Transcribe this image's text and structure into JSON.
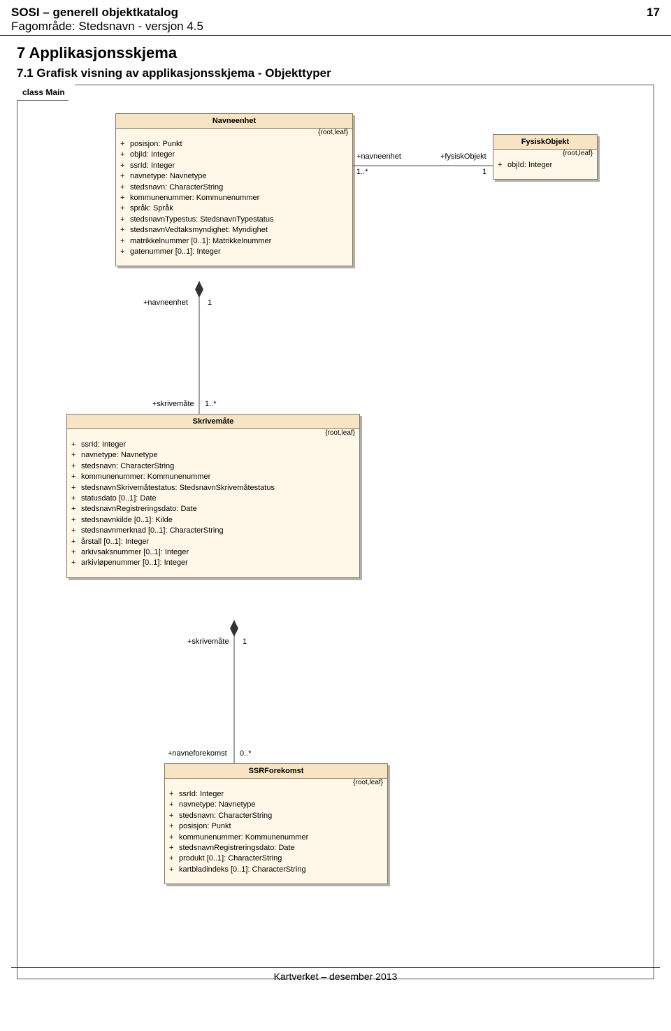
{
  "header": {
    "title_left": "SOSI – generell objektkatalog",
    "page_number": "17",
    "subtitle": "Fagområde: Stedsnavn - versjon 4.5"
  },
  "section": {
    "h1": "7 Applikasjonsskjema",
    "h2": "7.1 Grafisk visning av applikasjonsskjema - Objekttyper",
    "frame_label": "class Main"
  },
  "navneenhet": {
    "title": "Navneenhet",
    "constraint": "{root,leaf}",
    "attrs": [
      "posisjon: Punkt",
      "objId: Integer",
      "ssrId: Integer",
      "navnetype: Navnetype",
      "stedsnavn: CharacterString",
      "kommunenummer: Kommunenummer",
      "språk: Språk",
      "stedsnavnTypestus: StedsnavnTypestatus",
      "stedsnavnVedtaksmyndighet: Myndighet",
      "matrikkelnummer [0..1]: Matrikkelnummer",
      "gatenummer [0..1]: Integer"
    ]
  },
  "fysiskobjekt": {
    "title": "FysiskObjekt",
    "constraint": "{root,leaf}",
    "attr": "objId: Integer"
  },
  "assoc1": {
    "role_left": "+navneenhet",
    "mult_left": "1..*",
    "role_right": "+fysiskObjekt",
    "mult_right": "1"
  },
  "assoc2": {
    "role_top": "+navneenhet",
    "mult_top": "1",
    "role_bottom": "+skrivemåte",
    "mult_bottom": "1..*"
  },
  "skrivemate": {
    "title": "Skrivemåte",
    "constraint": "{root,leaf}",
    "attrs": [
      "ssrId: Integer",
      "navnetype: Navnetype",
      "stedsnavn: CharacterString",
      "kommunenummer: Kommunenummer",
      "stedsnavnSkrivemåtestatus: StedsnavnSkrivemåtestatus",
      "statusdato [0..1]: Date",
      "stedsnavnRegistreringsdato: Date",
      "stedsnavnkilde [0..1]: Kilde",
      "stedsnavnmerknad [0..1]: CharacterString",
      "årstall [0..1]: Integer",
      "arkivsaksnummer [0..1]: Integer",
      "arkivløpenummer [0..1]: Integer"
    ]
  },
  "assoc3": {
    "role_top": "+skrivemåte",
    "mult_top": "1",
    "role_bottom": "+navneforekomst",
    "mult_bottom": "0..*"
  },
  "ssrforekomst": {
    "title": "SSRForekomst",
    "constraint": "{root,leaf}",
    "attrs": [
      "ssrId: Integer",
      "navnetype: Navnetype",
      "stedsnavn: CharacterString",
      "posisjon: Punkt",
      "kommunenummer: Kommunenummer",
      "stedsnavnRegistreringsdato: Date",
      "produkt [0..1]: CharacterString",
      "kartbladindeks [0..1]: CharacterString"
    ]
  },
  "footer": {
    "text": "Kartverket – desember 2013"
  }
}
